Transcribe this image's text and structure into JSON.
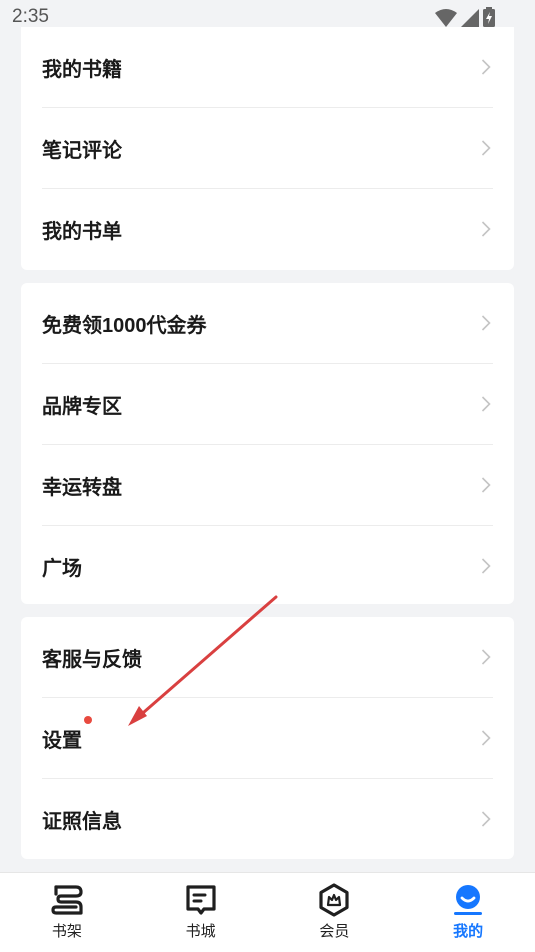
{
  "status_bar": {
    "time": "2:35"
  },
  "sections": [
    {
      "items": [
        {
          "label": "我的书籍"
        },
        {
          "label": "笔记评论"
        },
        {
          "label": "我的书单"
        }
      ]
    },
    {
      "items": [
        {
          "label": "免费领1000代金券"
        },
        {
          "label": "品牌专区"
        },
        {
          "label": "幸运转盘"
        },
        {
          "label": "广场"
        }
      ]
    },
    {
      "items": [
        {
          "label": "客服与反馈"
        },
        {
          "label": "设置",
          "badge": "red-dot"
        },
        {
          "label": "证照信息"
        }
      ]
    }
  ],
  "tabbar": {
    "tabs": [
      {
        "label": "书架",
        "icon": "bookshelf-icon"
      },
      {
        "label": "书城",
        "icon": "bookstore-icon"
      },
      {
        "label": "会员",
        "icon": "membership-icon"
      },
      {
        "label": "我的",
        "icon": "profile-icon",
        "active": true
      }
    ]
  },
  "colors": {
    "accent": "#1677ff",
    "badge": "#e84a3f",
    "annotation": "#d94040",
    "background": "#f2f3f5"
  }
}
